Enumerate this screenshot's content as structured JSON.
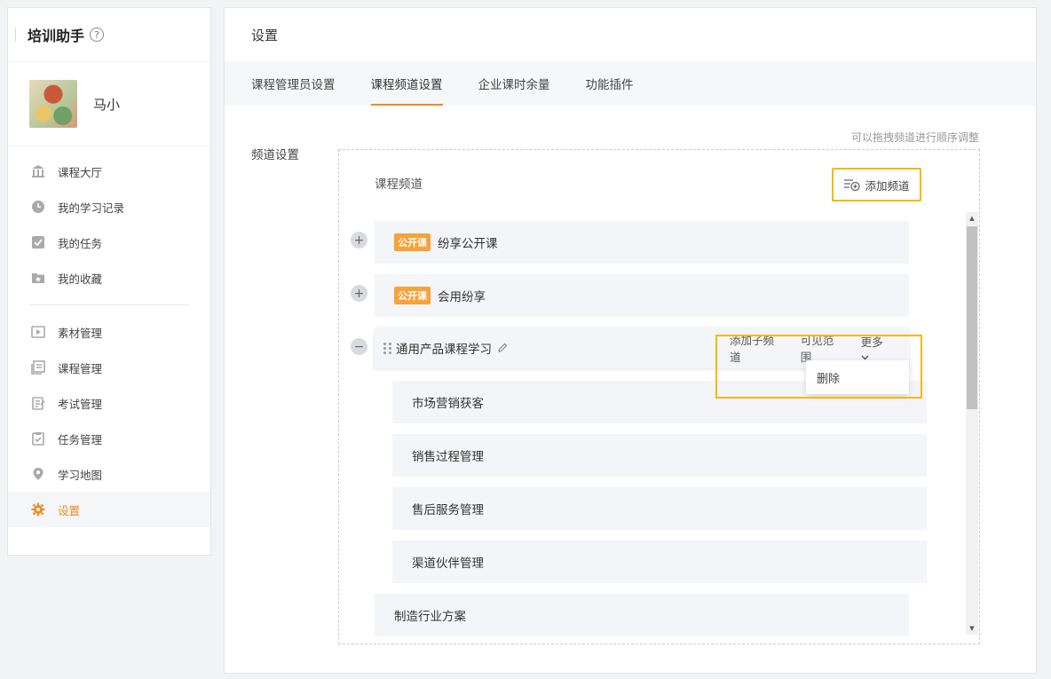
{
  "sidebar": {
    "title": "培训助手",
    "help": "?",
    "user_name": "马小",
    "items": [
      {
        "label": "课程大厅",
        "icon": "building-icon"
      },
      {
        "label": "我的学习记录",
        "icon": "clock-icon"
      },
      {
        "label": "我的任务",
        "icon": "check-icon"
      },
      {
        "label": "我的收藏",
        "icon": "star-folder-icon"
      },
      {
        "label": "素材管理",
        "icon": "play-icon"
      },
      {
        "label": "课程管理",
        "icon": "course-icon"
      },
      {
        "label": "考试管理",
        "icon": "exam-icon"
      },
      {
        "label": "任务管理",
        "icon": "task-icon"
      },
      {
        "label": "学习地图",
        "icon": "location-icon"
      },
      {
        "label": "设置",
        "icon": "gear-icon"
      }
    ],
    "active_color": "#f08a24"
  },
  "main": {
    "title": "设置",
    "tabs": [
      {
        "label": "课程管理员设置"
      },
      {
        "label": "课程频道设置"
      },
      {
        "label": "企业课时余量"
      },
      {
        "label": "功能插件"
      }
    ],
    "active_tab": "课程频道设置",
    "section_label": "频道设置",
    "hint": "可以拖拽频道进行顺序调整",
    "panel_title": "课程频道",
    "add_channel_label": "添加频道",
    "channels": [
      {
        "badge": "公开课",
        "name": "纷享公开课",
        "toggle": "+"
      },
      {
        "badge": "公开课",
        "name": "会用纷享",
        "toggle": "+"
      },
      {
        "name": "通用产品课程学习",
        "toggle": "−"
      }
    ],
    "row_actions": {
      "add_sub": "添加子频道",
      "visibility": "可见范围",
      "more": "更多"
    },
    "dropdown_item": "删除",
    "sub_channels": [
      "市场营销获客",
      "销售过程管理",
      "售后服务管理",
      "渠道伙伴管理"
    ],
    "last_channel": "制造行业方案"
  }
}
